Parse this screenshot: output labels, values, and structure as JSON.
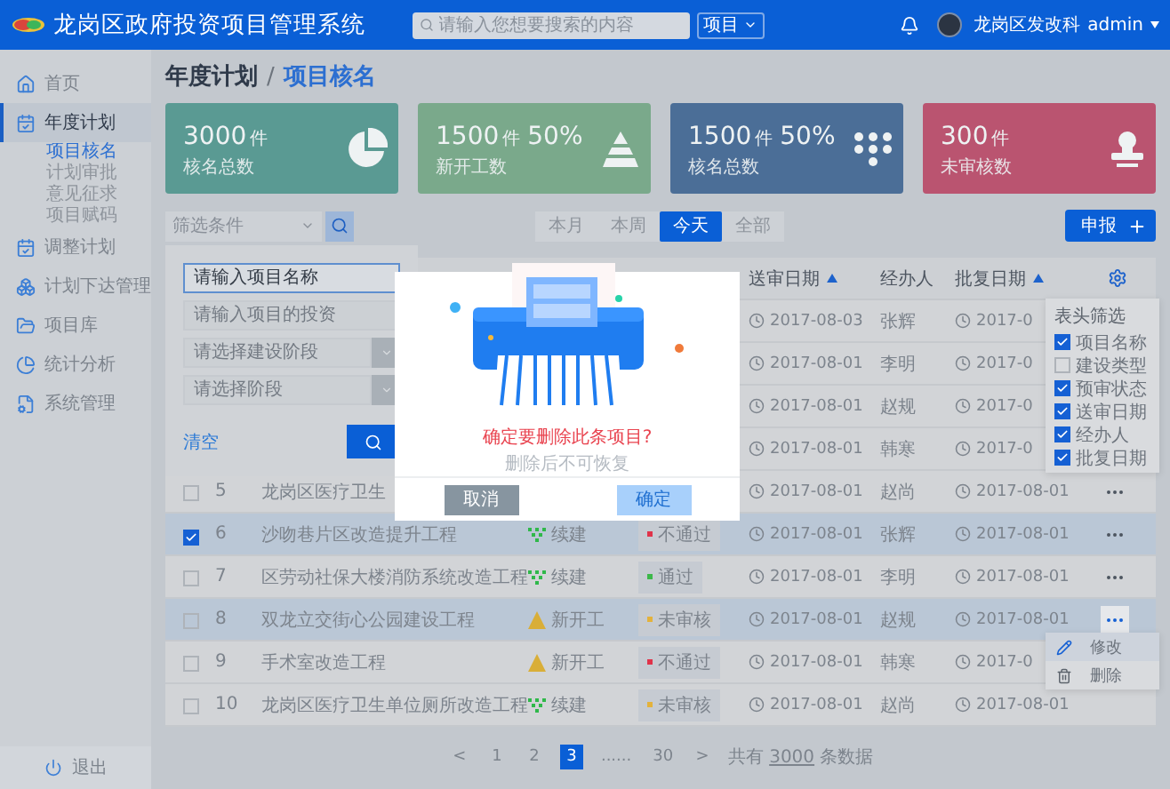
{
  "header": {
    "title": "龙岗区政府投资项目管理系统",
    "search": {
      "placeholder": "请输入您想要搜索的内容",
      "scope": "项目"
    },
    "user": {
      "department": "龙岗区发改科",
      "name": "admin"
    }
  },
  "sidebar": {
    "items": [
      {
        "label": "首页",
        "selected": false
      },
      {
        "label": "年度计划",
        "selected": true,
        "expanded": true,
        "children": [
          {
            "label": "项目核名",
            "selected": true
          },
          {
            "label": "计划审批",
            "selected": false
          },
          {
            "label": "意见征求",
            "selected": false
          },
          {
            "label": "项目赋码",
            "selected": false
          }
        ]
      },
      {
        "label": "调整计划",
        "selected": false
      },
      {
        "label": "计划下达管理",
        "selected": false
      },
      {
        "label": "项目库",
        "selected": false
      },
      {
        "label": "统计分析",
        "selected": false
      },
      {
        "label": "系统管理",
        "selected": false
      }
    ],
    "logout": "退出"
  },
  "breadcrumb": {
    "parent": "年度计划",
    "separator": "/",
    "current": "项目核名"
  },
  "cards": [
    {
      "value": "3000",
      "unit": "件",
      "label": "核名总数",
      "color": "#5a9a93"
    },
    {
      "value": "1500",
      "unit": "件",
      "percent": "50%",
      "label": "新开工数",
      "color": "#7aa98b"
    },
    {
      "value": "1500",
      "unit": "件",
      "percent": "50%",
      "label": "核名总数",
      "color": "#4b6e97"
    },
    {
      "value": "300",
      "unit": "件",
      "label": "未审核数",
      "color": "#ba5470"
    }
  ],
  "toolbar": {
    "filter": "筛选条件",
    "periods": [
      {
        "label": "本月",
        "selected": false
      },
      {
        "label": "本周",
        "selected": false
      },
      {
        "label": "今天",
        "selected": true
      },
      {
        "label": "全部",
        "selected": false
      }
    ],
    "report_button": "申报"
  },
  "filter_panel": {
    "fields": [
      {
        "kind": "input",
        "placeholder": "请输入项目名称",
        "focused": true
      },
      {
        "kind": "input",
        "placeholder": "请输入项目的投资",
        "focused": false
      },
      {
        "kind": "select",
        "placeholder": "请选择建设阶段",
        "focused": false
      },
      {
        "kind": "select",
        "placeholder": "请选择阶段",
        "focused": false
      }
    ],
    "clear": "清空"
  },
  "table": {
    "columns": [
      {
        "label": "送审日期",
        "sortable": true
      },
      {
        "label": "经办人",
        "sortable": false
      },
      {
        "label": "批复日期",
        "sortable": true
      }
    ],
    "rows": [
      {
        "submitted": "2017-08-03",
        "handler": "张辉",
        "approved": "2017-0"
      },
      {
        "submitted": "2017-08-01",
        "handler": "李明",
        "approved": "2017-0"
      },
      {
        "submitted": "2017-08-01",
        "handler": "赵规",
        "approved": "2017-0"
      },
      {
        "submitted": "2017-08-01",
        "handler": "韩寒",
        "approved": "2017-0"
      },
      {
        "checked": false,
        "highlighted": false,
        "no": "5",
        "name": "龙岗区医疗卫生",
        "submitted": "2017-08-01",
        "handler": "赵尚",
        "approved": "2017-08-01",
        "more": {
          "active": false
        }
      },
      {
        "checked": true,
        "highlighted": true,
        "no": "6",
        "name": "沙吻巷片区改造提升工程",
        "type": {
          "kind": "continue",
          "label": "续建"
        },
        "status": {
          "label": "不通过",
          "color": "#e0334a"
        },
        "submitted": "2017-08-01",
        "handler": "张辉",
        "approved": "2017-08-01",
        "more": {
          "active": false
        }
      },
      {
        "checked": false,
        "highlighted": false,
        "no": "7",
        "name": "区劳动社保大楼消防系统改造工程",
        "type": {
          "kind": "continue",
          "label": "续建"
        },
        "status": {
          "label": "通过",
          "color": "#3cb84a"
        },
        "submitted": "2017-08-01",
        "handler": "李明",
        "approved": "2017-08-01",
        "more": {
          "active": false
        }
      },
      {
        "checked": false,
        "highlighted": true,
        "no": "8",
        "name": "双龙立交街心公园建设工程",
        "type": {
          "kind": "new",
          "label": "新开工"
        },
        "status": {
          "label": "未审核",
          "color": "#e3b23c"
        },
        "submitted": "2017-08-01",
        "handler": "赵规",
        "approved": "2017-08-01",
        "more": {
          "active": true
        }
      },
      {
        "checked": false,
        "highlighted": false,
        "no": "9",
        "name": "手术室改造工程",
        "type": {
          "kind": "new",
          "label": "新开工"
        },
        "status": {
          "label": "不通过",
          "color": "#e0334a"
        },
        "submitted": "2017-08-01",
        "handler": "韩寒",
        "approved": "2017-0"
      },
      {
        "checked": false,
        "highlighted": false,
        "no": "10",
        "name": "龙岗区医疗卫生单位厕所改造工程",
        "type": {
          "kind": "continue",
          "label": "续建"
        },
        "status": {
          "label": "未审核",
          "color": "#e3b23c"
        },
        "submitted": "2017-08-01",
        "handler": "赵尚",
        "approved": "2017-08-01"
      }
    ]
  },
  "column_filter": {
    "title": "表头筛选",
    "options": [
      {
        "label": "项目名称",
        "checked": true
      },
      {
        "label": "建设类型",
        "checked": false
      },
      {
        "label": "预审状态",
        "checked": true
      },
      {
        "label": "送审日期",
        "checked": true
      },
      {
        "label": "经办人",
        "checked": true
      },
      {
        "label": "批复日期",
        "checked": true
      }
    ]
  },
  "row_menu": {
    "items": [
      {
        "label": "修改",
        "selected": true
      },
      {
        "label": "删除",
        "selected": false
      }
    ]
  },
  "pagination": {
    "pages": [
      {
        "label": "1",
        "selected": false
      },
      {
        "label": "2",
        "selected": false
      },
      {
        "label": "3",
        "selected": true
      },
      {
        "label": "......",
        "selected": false
      },
      {
        "label": "30",
        "selected": false
      }
    ],
    "prev": "<",
    "next": ">",
    "total_prefix": "共有",
    "total": "3000",
    "total_suffix": "条数据"
  },
  "dialog": {
    "message": "确定要删除此条项目?",
    "hint": "删除后不可恢复",
    "buttons": [
      {
        "label": "取消",
        "kind": "cancel"
      },
      {
        "label": "确定",
        "kind": "confirm"
      }
    ]
  }
}
